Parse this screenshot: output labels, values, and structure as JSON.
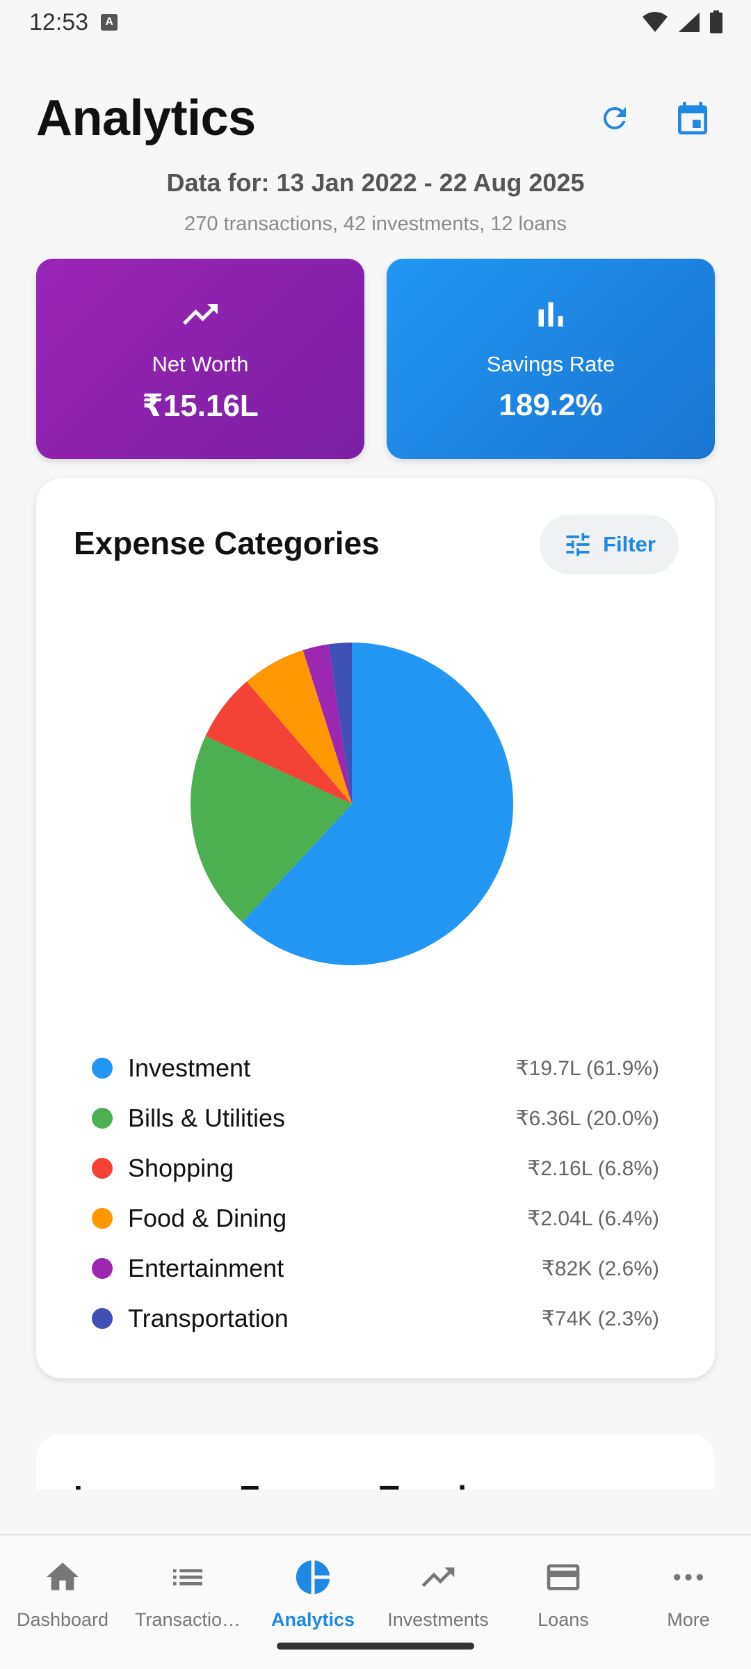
{
  "status_bar": {
    "time": "12:53",
    "badge": "A"
  },
  "header": {
    "title": "Analytics"
  },
  "summary": {
    "date_range": "Data for: 13 Jan 2022 - 22 Aug 2025",
    "counts": "270 transactions, 42 investments, 12 loans"
  },
  "stats": {
    "net_worth": {
      "label": "Net Worth",
      "value": "₹15.16L",
      "icon": "trending-up-icon",
      "color": "#8e24aa"
    },
    "savings_rate": {
      "label": "Savings Rate",
      "value": "189.2%",
      "icon": "bar-chart-icon",
      "color": "#1e88e5"
    }
  },
  "expense_card": {
    "title": "Expense Categories",
    "filter_label": "Filter",
    "categories": [
      {
        "name": "Investment",
        "value": "₹19.7L (61.9%)",
        "percent": 61.9,
        "color": "#2196f3"
      },
      {
        "name": "Bills & Utilities",
        "value": "₹6.36L (20.0%)",
        "percent": 20.0,
        "color": "#4caf50"
      },
      {
        "name": "Shopping",
        "value": "₹2.16L (6.8%)",
        "percent": 6.8,
        "color": "#f44336"
      },
      {
        "name": "Food & Dining",
        "value": "₹2.04L (6.4%)",
        "percent": 6.4,
        "color": "#ff9800"
      },
      {
        "name": "Entertainment",
        "value": "₹82K (2.6%)",
        "percent": 2.6,
        "color": "#9c27b0"
      },
      {
        "name": "Transportation",
        "value": "₹74K (2.3%)",
        "percent": 2.3,
        "color": "#3f51b5"
      }
    ]
  },
  "trend_card": {
    "title": "Income vs Expense Trend"
  },
  "nav": {
    "items": [
      {
        "label": "Dashboard",
        "icon": "home-icon"
      },
      {
        "label": "Transactio…",
        "icon": "list-icon"
      },
      {
        "label": "Analytics",
        "icon": "pie-chart-icon",
        "active": true
      },
      {
        "label": "Investments",
        "icon": "trending-up-icon"
      },
      {
        "label": "Loans",
        "icon": "credit-card-icon"
      },
      {
        "label": "More",
        "icon": "more-icon"
      }
    ]
  }
}
